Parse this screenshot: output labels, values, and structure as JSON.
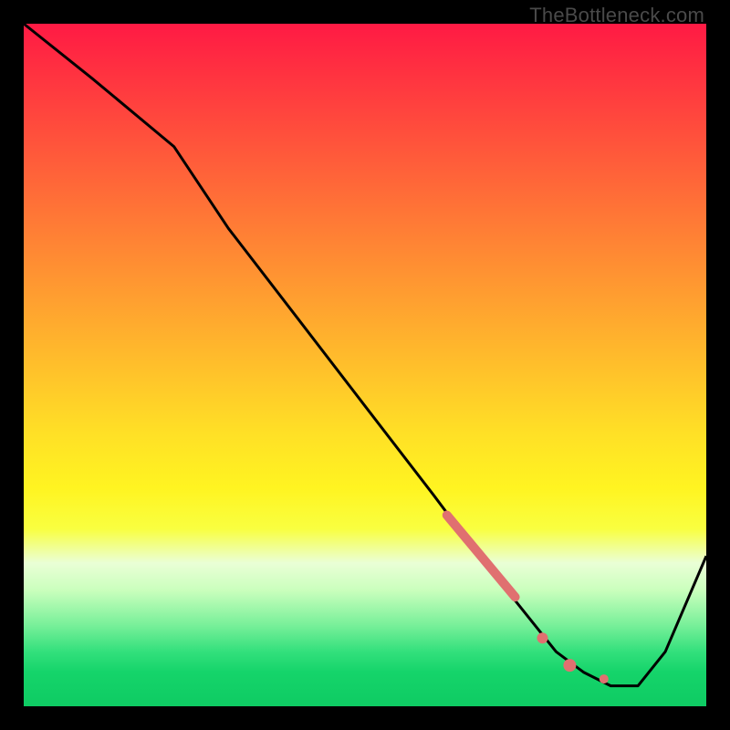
{
  "watermark": "TheBottleneck.com",
  "chart_data": {
    "type": "line",
    "title": "",
    "xlabel": "",
    "ylabel": "",
    "xlim": [
      0,
      100
    ],
    "ylim": [
      0,
      100
    ],
    "grid": false,
    "series": [
      {
        "name": "bottleneck-curve",
        "color": "#000000",
        "x": [
          0,
          10,
          22,
          30,
          40,
          50,
          60,
          66,
          70,
          74,
          78,
          82,
          86,
          90,
          94,
          100
        ],
        "y": [
          100,
          92,
          82,
          70,
          57,
          44,
          31,
          23,
          18,
          13,
          8,
          5,
          3,
          3,
          8,
          22
        ]
      }
    ],
    "markers": [
      {
        "name": "thick-segment",
        "shape": "thick-line",
        "color": "#e07070",
        "x0": 62,
        "y0": 28,
        "x1": 72,
        "y1": 16,
        "width": 10
      },
      {
        "name": "dot-mid",
        "shape": "circle",
        "color": "#e07070",
        "x": 76,
        "y": 10,
        "r": 6
      },
      {
        "name": "dot-low-1",
        "shape": "circle",
        "color": "#e07070",
        "x": 80,
        "y": 6,
        "r": 7
      },
      {
        "name": "dot-low-2",
        "shape": "circle",
        "color": "#e07070",
        "x": 85,
        "y": 4,
        "r": 5
      }
    ],
    "background_gradient": {
      "direction": "vertical",
      "stops": [
        {
          "pos": 0,
          "color": "#ff1a44"
        },
        {
          "pos": 50,
          "color": "#ffbf2b"
        },
        {
          "pos": 74,
          "color": "#f9ff40"
        },
        {
          "pos": 100,
          "color": "#0ecb63"
        }
      ]
    }
  }
}
